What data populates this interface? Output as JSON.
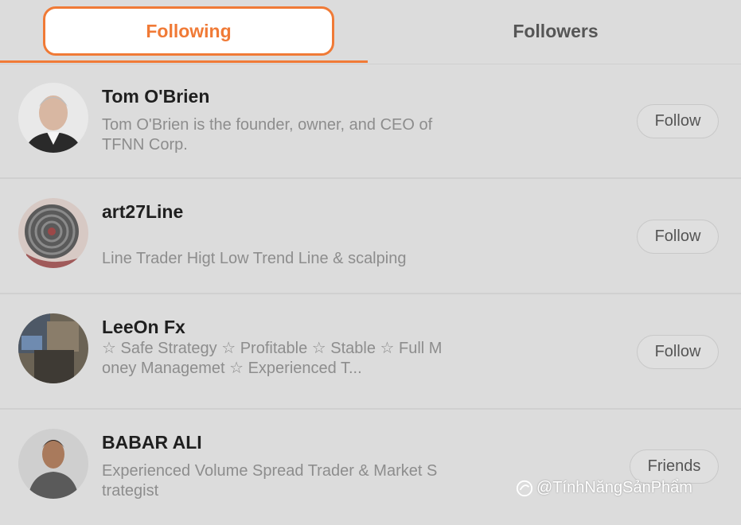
{
  "tabs": {
    "following": "Following",
    "followers": "Followers"
  },
  "users": [
    {
      "name": "Tom O'Brien",
      "description": "Tom O'Brien is the founder, owner, and CEO of TFNN Corp.",
      "button": "Follow"
    },
    {
      "name": "art27Line",
      "description": "Line Trader Higt Low Trend Line & scalping",
      "button": "Follow"
    },
    {
      "name": "LeeOn Fx",
      "description": "☆ Safe Strategy ☆ Profitable ☆ Stable ☆ Full Money Managemet ☆ Experienced T...",
      "button": "Follow"
    },
    {
      "name": "BABAR ALI",
      "description": "Experienced Volume Spread Trader & Market Strategist",
      "button": "Friends"
    }
  ],
  "watermark": "@TínhNăngSảnPhẩm",
  "colors": {
    "accent": "#f07a36",
    "background": "#dcdcdc",
    "name_text": "#1f1f1f",
    "description_text": "#8d8d8d"
  }
}
